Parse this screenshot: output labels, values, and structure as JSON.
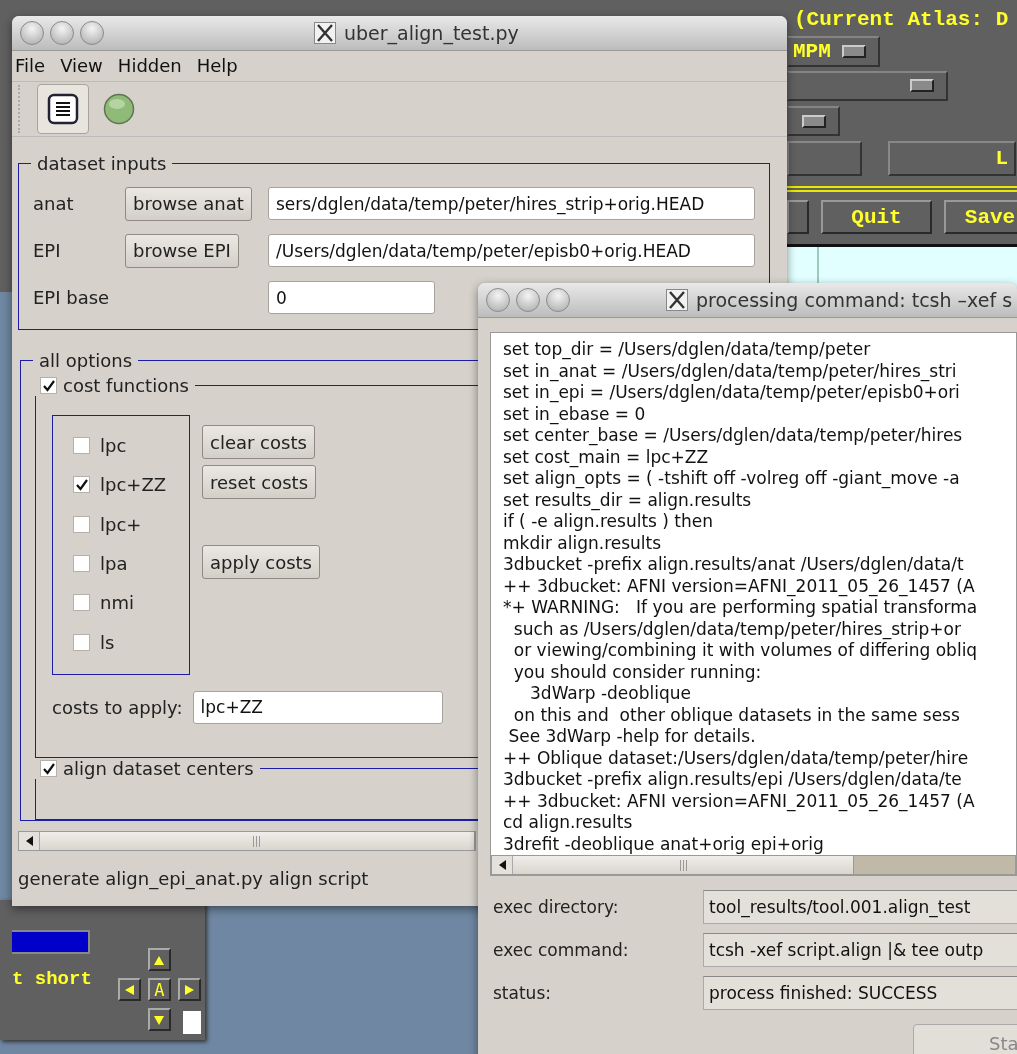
{
  "background_window": {
    "atlas_label": "(Current Atlas: D",
    "dropdown_value": "MPM",
    "partial_button": "L",
    "buttons": [
      "Quit",
      "Save"
    ]
  },
  "background_panel": {
    "label": "t short",
    "center_key": "A"
  },
  "main_window": {
    "title": "uber_align_test.py",
    "menus": [
      "File",
      "View",
      "Hidden",
      "Help"
    ],
    "dataset_inputs": {
      "title": "dataset inputs",
      "rows": [
        {
          "label": "anat",
          "button": "browse anat",
          "value": "sers/dglen/data/temp/peter/hires_strip+orig.HEAD"
        },
        {
          "label": "EPI",
          "button": "browse EPI",
          "value": "/Users/dglen/data/temp/peter/episb0+orig.HEAD"
        },
        {
          "label": "EPI base",
          "value": "0"
        }
      ]
    },
    "all_options": {
      "title": "all options",
      "cost_functions": {
        "title": "cost functions",
        "checked": true,
        "costs": [
          {
            "label": "lpc",
            "checked": false
          },
          {
            "label": "lpc+ZZ",
            "checked": true
          },
          {
            "label": "lpc+",
            "checked": false
          },
          {
            "label": "lpa",
            "checked": false
          },
          {
            "label": "nmi",
            "checked": false
          },
          {
            "label": "ls",
            "checked": false
          }
        ],
        "buttons": [
          "clear costs",
          "reset costs",
          "apply costs"
        ],
        "apply_label": "costs to apply:",
        "apply_value": "lpc+ZZ"
      },
      "align_centers": {
        "title": "align dataset centers",
        "checked": true
      }
    },
    "status_text": "generate align_epi_anat.py align script"
  },
  "process_window": {
    "title": "processing command: tcsh –xef s",
    "output_lines": [
      "set top_dir = /Users/dglen/data/temp/peter",
      "set in_anat = /Users/dglen/data/temp/peter/hires_stri",
      "set in_epi = /Users/dglen/data/temp/peter/episb0+ori",
      "set in_ebase = 0",
      "set center_base = /Users/dglen/data/temp/peter/hires",
      "set cost_main = lpc+ZZ",
      "set align_opts = ( -tshift off -volreg off -giant_move -a",
      "set results_dir = align.results",
      "if ( -e align.results ) then",
      "mkdir align.results",
      "3dbucket -prefix align.results/anat /Users/dglen/data/t",
      "++ 3dbucket: AFNI version=AFNI_2011_05_26_1457 (A",
      "*+ WARNING:   If you are performing spatial transforma",
      "  such as /Users/dglen/data/temp/peter/hires_strip+or",
      "  or viewing/combining it with volumes of differing obliq",
      "  you should consider running:",
      "     3dWarp -deoblique",
      "  on this and  other oblique datasets in the same sess",
      " See 3dWarp -help for details.",
      "++ Oblique dataset:/Users/dglen/data/temp/peter/hire",
      "3dbucket -prefix align.results/epi /Users/dglen/data/te",
      "++ 3dbucket: AFNI version=AFNI_2011_05_26_1457 (A",
      "cd align.results",
      "3drefit -deoblique anat+orig epi+orig"
    ],
    "fields": [
      {
        "label": "exec directory:",
        "value": "tool_results/tool.001.align_test"
      },
      {
        "label": "exec command:",
        "value": "tcsh -xef script.align |& tee outp"
      },
      {
        "label": "status:",
        "value": "process finished: SUCCESS"
      }
    ],
    "button": "Sta"
  }
}
